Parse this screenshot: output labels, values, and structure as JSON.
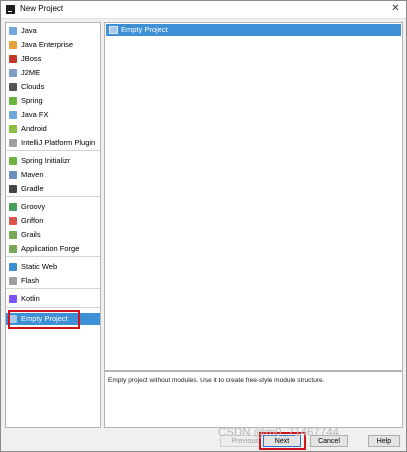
{
  "window": {
    "title": "New Project"
  },
  "project_types": [
    {
      "label": "Java",
      "icon": "java-folder-icon",
      "color": "#6fa8dc"
    },
    {
      "label": "Java Enterprise",
      "icon": "java-ee-icon",
      "color": "#e6a23c"
    },
    {
      "label": "JBoss",
      "icon": "jboss-icon",
      "color": "#c0392b"
    },
    {
      "label": "J2ME",
      "icon": "j2me-icon",
      "color": "#7d9ec0"
    },
    {
      "label": "Clouds",
      "icon": "clouds-icon",
      "color": "#555555"
    },
    {
      "label": "Spring",
      "icon": "spring-icon",
      "color": "#6db33f"
    },
    {
      "label": "Java FX",
      "icon": "javafx-folder-icon",
      "color": "#6fa8dc"
    },
    {
      "label": "Android",
      "icon": "android-icon",
      "color": "#8bbd3d"
    },
    {
      "label": "IntelliJ Platform Plugin",
      "icon": "plugin-icon",
      "color": "#9e9e9e"
    },
    {
      "label": "Spring Initializr",
      "icon": "spring-initializr-icon",
      "color": "#6db33f"
    },
    {
      "label": "Maven",
      "icon": "maven-icon",
      "color": "#6c8ebf"
    },
    {
      "label": "Gradle",
      "icon": "gradle-icon",
      "color": "#444444"
    },
    {
      "label": "Groovy",
      "icon": "groovy-icon",
      "color": "#4a9e5c"
    },
    {
      "label": "Griffon",
      "icon": "griffon-icon",
      "color": "#d9534f"
    },
    {
      "label": "Grails",
      "icon": "grails-icon",
      "color": "#77a854"
    },
    {
      "label": "Application Forge",
      "icon": "application-forge-icon",
      "color": "#77a854"
    },
    {
      "label": "Static Web",
      "icon": "static-web-icon",
      "color": "#3b8ed0"
    },
    {
      "label": "Flash",
      "icon": "flash-icon",
      "color": "#9e9e9e"
    },
    {
      "label": "Kotlin",
      "icon": "kotlin-icon",
      "color": "#7f52ff"
    },
    {
      "label": "Empty Project",
      "icon": "empty-project-folder-icon",
      "color": "#a9c8e8"
    }
  ],
  "selected_type": "Empty Project",
  "templates": [
    {
      "label": "Empty Project",
      "icon": "empty-project-folder-icon"
    }
  ],
  "description": "Empty project without modules. Use it to create free-style module structure.",
  "buttons": {
    "previous": "Previous",
    "next": "Next",
    "cancel": "Cancel",
    "help": "Help"
  },
  "watermark": "CSDN @m0_71467744",
  "colors": {
    "selection": "#3d8fd6",
    "highlight": "#d0121b"
  }
}
